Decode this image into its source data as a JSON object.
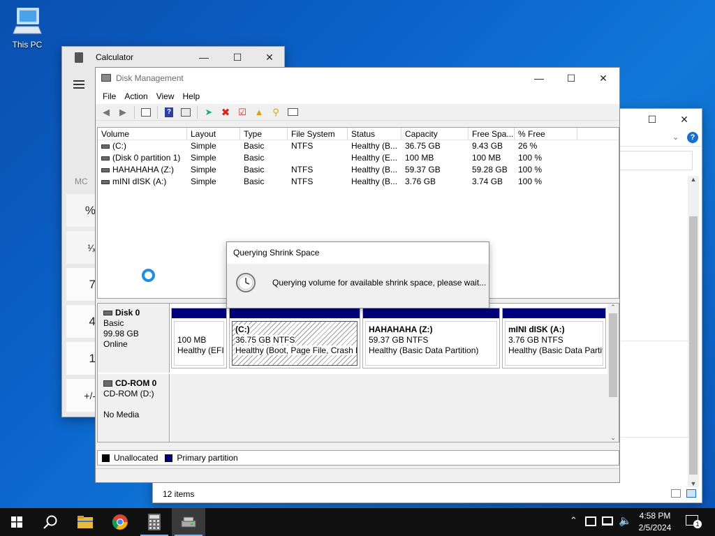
{
  "desktop": {
    "icon_label": "This PC"
  },
  "calculator": {
    "title": "Calculator",
    "menu_icon": "hamburger-icon",
    "memory_label": "MC",
    "buttons": [
      "%",
      "¹⁄ₓ",
      "7",
      "4",
      "1",
      "+/-"
    ]
  },
  "explorer": {
    "status": "12 items"
  },
  "disk_management": {
    "title": "Disk Management",
    "menu": [
      "File",
      "Action",
      "View",
      "Help"
    ],
    "toolbar_icons": [
      "back-icon",
      "forward-icon",
      "console-tree-icon",
      "help-icon",
      "properties-icon",
      "connect-icon",
      "delete-icon",
      "check-icon",
      "open-icon",
      "search-icon",
      "list-icon"
    ],
    "columns": [
      "Volume",
      "Layout",
      "Type",
      "File System",
      "Status",
      "Capacity",
      "Free Spa...",
      "% Free"
    ],
    "volumes": [
      {
        "volume": "(C:)",
        "layout": "Simple",
        "type": "Basic",
        "fs": "NTFS",
        "status": "Healthy (B...",
        "capacity": "36.75 GB",
        "free": "9.43 GB",
        "pct": "26 %"
      },
      {
        "volume": "(Disk 0 partition 1)",
        "layout": "Simple",
        "type": "Basic",
        "fs": "",
        "status": "Healthy (E...",
        "capacity": "100 MB",
        "free": "100 MB",
        "pct": "100 %"
      },
      {
        "volume": "HAHAHAHA (Z:)",
        "layout": "Simple",
        "type": "Basic",
        "fs": "NTFS",
        "status": "Healthy (B...",
        "capacity": "59.37 GB",
        "free": "59.28 GB",
        "pct": "100 %"
      },
      {
        "volume": "mINI dISK (A:)",
        "layout": "Simple",
        "type": "Basic",
        "fs": "NTFS",
        "status": "Healthy (B...",
        "capacity": "3.76 GB",
        "free": "3.74 GB",
        "pct": "100 %"
      }
    ],
    "disk0": {
      "name": "Disk 0",
      "type": "Basic",
      "size": "99.98 GB",
      "state": "Online",
      "partitions": [
        {
          "title": "",
          "size": "100 MB",
          "status": "Healthy (EFI"
        },
        {
          "title": "(C:)",
          "size": "36.75 GB NTFS",
          "status": "Healthy (Boot, Page File, Crash Du"
        },
        {
          "title": "HAHAHAHA  (Z:)",
          "size": "59.37 GB NTFS",
          "status": "Healthy (Basic Data Partition)"
        },
        {
          "title": "mINI dISK  (A:)",
          "size": "3.76 GB NTFS",
          "status": "Healthy (Basic Data Partiti"
        }
      ]
    },
    "cdrom": {
      "name": "CD-ROM 0",
      "drive": "CD-ROM (D:)",
      "media": "No Media"
    },
    "legend": {
      "unallocated": "Unallocated",
      "primary": "Primary partition"
    },
    "colors": {
      "primary": "#00007b",
      "unallocated": "#000000"
    }
  },
  "dialog": {
    "title": "Querying Shrink Space",
    "message": "Querying volume for available shrink space, please wait...",
    "icon": "clock-icon"
  },
  "taskbar": {
    "apps": [
      "start-icon",
      "search-icon",
      "file-explorer-icon",
      "chrome-icon",
      "calculator-icon",
      "disk-management-icon"
    ],
    "time": "4:58 PM",
    "date": "2/5/2024",
    "notification_count": "1"
  }
}
